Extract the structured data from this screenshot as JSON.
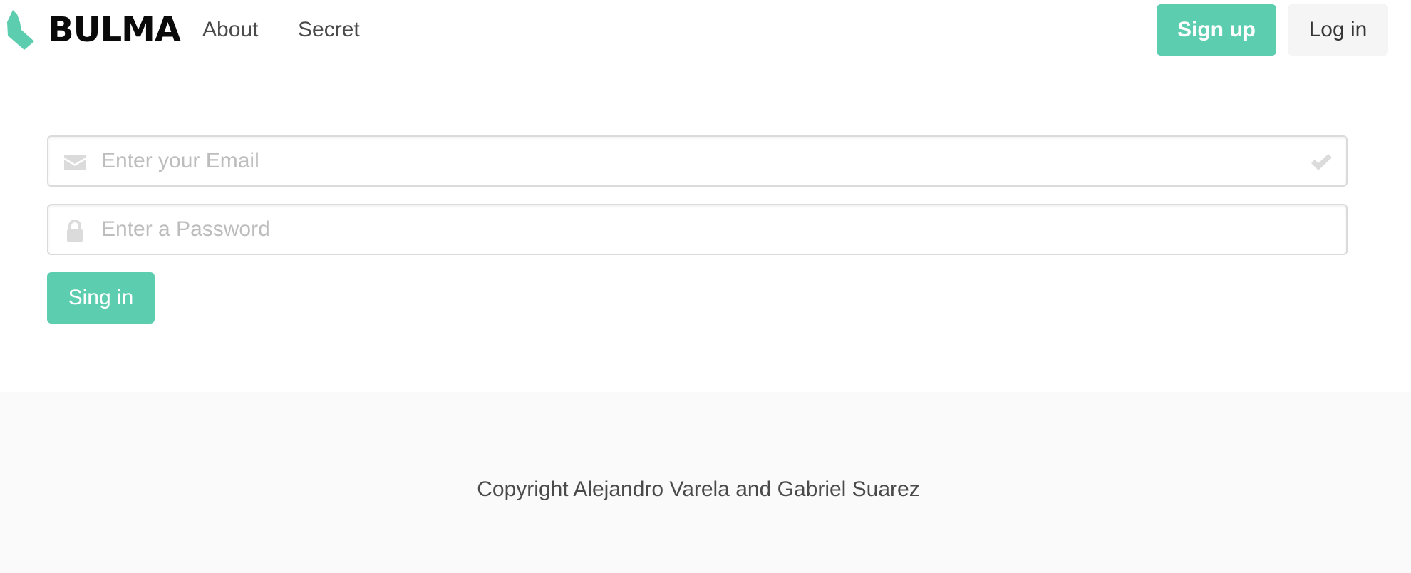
{
  "navbar": {
    "brand_name": "BULMA",
    "links": [
      "About",
      "Secret"
    ],
    "signup_label": "Sign up",
    "login_label": "Log in"
  },
  "form": {
    "email_placeholder": "Enter your Email",
    "email_value": "",
    "password_placeholder": "Enter a Password",
    "password_value": "",
    "submit_label": "Sing in"
  },
  "footer": {
    "copyright": "Copyright Alejandro Varela and Gabriel Suarez"
  },
  "icons": {
    "brand": "bulma-logo",
    "email_left": "envelope-icon",
    "email_right": "check-icon",
    "password_left": "lock-icon"
  },
  "colors": {
    "primary": "#5dcdb0",
    "light_button": "#f5f5f5",
    "footer_bg": "#fafafa",
    "icon_muted": "#dbdbdb"
  }
}
